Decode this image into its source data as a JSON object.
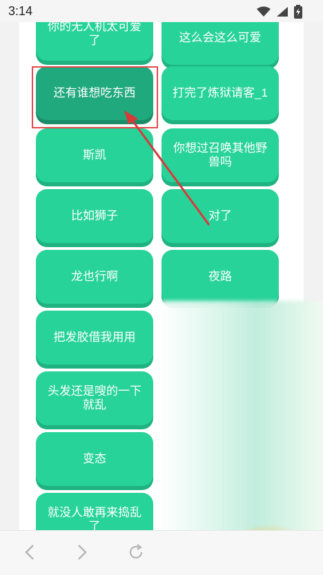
{
  "status_bar": {
    "time": "3:14"
  },
  "buttons": [
    {
      "label": "你的无人机太可爱了",
      "col": "left"
    },
    {
      "label": "这么会这么可爱",
      "col": "right"
    },
    {
      "label": "还有谁想吃东西",
      "col": "left",
      "state": "pressed"
    },
    {
      "label": "打完了炼狱请客_1",
      "col": "right"
    },
    {
      "label": "斯凯",
      "col": "left"
    },
    {
      "label": "你想过召唤其他野兽吗",
      "col": "right"
    },
    {
      "label": "比如狮子",
      "col": "left"
    },
    {
      "label": "对了",
      "col": "right"
    },
    {
      "label": "龙也行啊",
      "col": "left"
    },
    {
      "label": "夜路",
      "col": "right"
    },
    {
      "label": "把发胶借我用用",
      "col": "left"
    },
    {
      "label": "头发还是嗖的一下就乱",
      "col": "left"
    },
    {
      "label": "变态",
      "col": "left"
    },
    {
      "label": "就没人敢再来捣乱了",
      "col": "left"
    }
  ],
  "colors": {
    "button": "#27d399",
    "button_pressed": "#20a97c",
    "annotation": "#e04b4b"
  },
  "icons": {
    "nav": [
      "back-icon",
      "forward-icon",
      "refresh-icon"
    ],
    "status": [
      "wifi-icon",
      "signal-icon",
      "battery-icon"
    ]
  }
}
